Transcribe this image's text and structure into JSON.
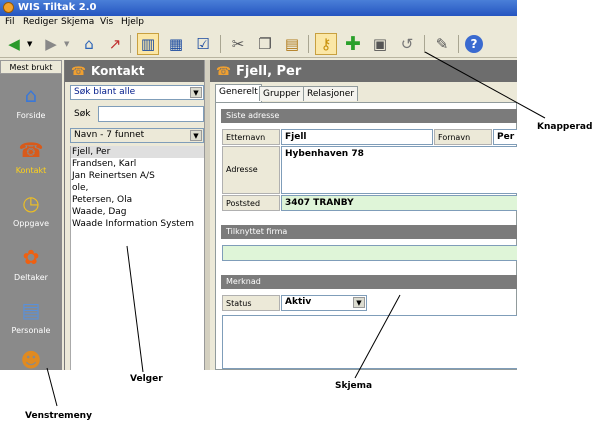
{
  "app": {
    "title": "WIS Tiltak 2.0"
  },
  "menu": [
    "Fil",
    "Rediger",
    "Skjema",
    "Vis",
    "Hjelp"
  ],
  "toolbar": {
    "icons": [
      "back-arrow-icon",
      "forward-arrow-icon",
      "home-icon",
      "chart-icon",
      "layout-icon",
      "grid-icon",
      "checkbox-icon",
      "cut-icon",
      "copy-icon",
      "paste-icon",
      "key-icon",
      "add-icon",
      "save-icon",
      "undo-icon",
      "edit-icon",
      "help-icon"
    ]
  },
  "left_menu": {
    "header": "Mest brukt",
    "items": [
      {
        "label": "Forside",
        "icon": "house-icon"
      },
      {
        "label": "Kontakt",
        "icon": "contact-icon"
      },
      {
        "label": "Oppgave",
        "icon": "clock-icon"
      },
      {
        "label": "Deltaker",
        "icon": "flower-icon"
      },
      {
        "label": "Personale",
        "icon": "id-card-icon"
      },
      {
        "label": "",
        "icon": "people-icon"
      }
    ]
  },
  "velger": {
    "title": "Kontakt",
    "search_scope": "Søk blant alle",
    "search_label": "Søk",
    "search_value": "",
    "sort_label": "Navn - 7 funnet",
    "items": [
      "Fjell, Per",
      "Frandsen, Karl",
      "Jan Reinertsen A/S",
      "ole,",
      "Petersen, Ola",
      "Waade, Dag",
      "Waade Information System"
    ]
  },
  "skjema": {
    "title": "Fjell, Per",
    "tabs": [
      "Generelt",
      "Grupper",
      "Relasjoner"
    ],
    "section_address": "Siste adresse",
    "fields": {
      "etternavn_label": "Etternavn",
      "etternavn": "Fjell",
      "fornavn_label": "Fornavn",
      "fornavn": "Per",
      "adresse_label": "Adresse",
      "adresse": "Hybenhaven 78",
      "poststed_label": "Poststed",
      "poststed": "3407 TRANBY"
    },
    "section_firma": "Tilknyttet firma",
    "section_merknad": "Merknad",
    "status_label": "Status",
    "status_value": "Aktiv"
  },
  "annotations": {
    "knapperad": "Knapperad",
    "velger": "Velger",
    "skjema": "Skjema",
    "venstremeny": "Venstremeny"
  }
}
